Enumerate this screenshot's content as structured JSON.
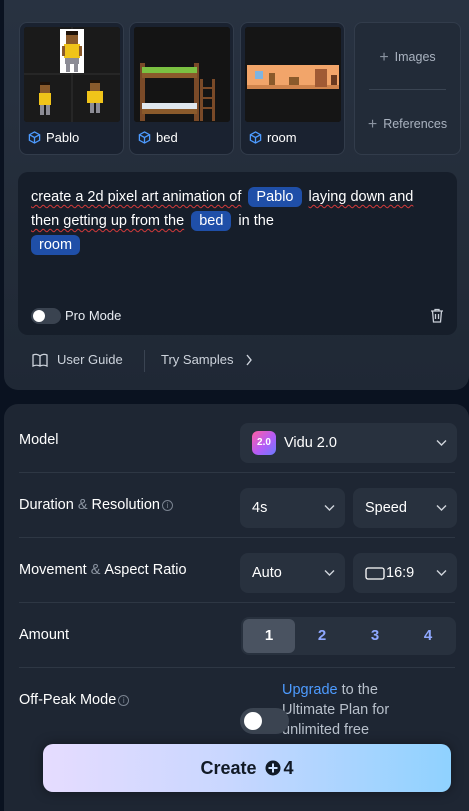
{
  "references": [
    {
      "label": "Pablo",
      "icon": "cube-icon"
    },
    {
      "label": "bed",
      "icon": "cube-icon"
    },
    {
      "label": "room",
      "icon": "cube-icon"
    }
  ],
  "add_card": {
    "images_label": "Images",
    "references_label": "References"
  },
  "prompt": {
    "part1": "create a 2d pixel art animation of",
    "chip1": "Pablo",
    "part2a": "laying down and",
    "part2b": "then getting up from the",
    "chip2": "bed",
    "part3": "in the",
    "chip3": "room"
  },
  "pro_mode": {
    "label": "Pro Mode",
    "enabled": false
  },
  "links": {
    "user_guide": "User Guide",
    "try_samples": "Try Samples"
  },
  "settings": {
    "model": {
      "label": "Model",
      "value": "Vidu 2.0",
      "logo_text": "2.0"
    },
    "duration_resolution": {
      "label_a": "Duration",
      "amp": "&",
      "label_b": "Resolution",
      "duration": "4s",
      "resolution": "Speed"
    },
    "movement_aspect": {
      "label_a": "Movement",
      "amp": "&",
      "label_b": "Aspect Ratio",
      "movement": "Auto",
      "aspect": "16:9"
    },
    "amount": {
      "label": "Amount",
      "options": [
        "1",
        "2",
        "3",
        "4"
      ],
      "selected": "1"
    },
    "off_peak": {
      "label": "Off-Peak Mode",
      "enabled": false,
      "upgrade_link": "Upgrade",
      "upgrade_text": " to the Ultimate Plan for unlimited free"
    }
  },
  "create": {
    "label": "Create",
    "credits": "4"
  },
  "colors": {
    "accent": "#1f4fa8",
    "link": "#4d9bff",
    "background": "#0a1220"
  }
}
